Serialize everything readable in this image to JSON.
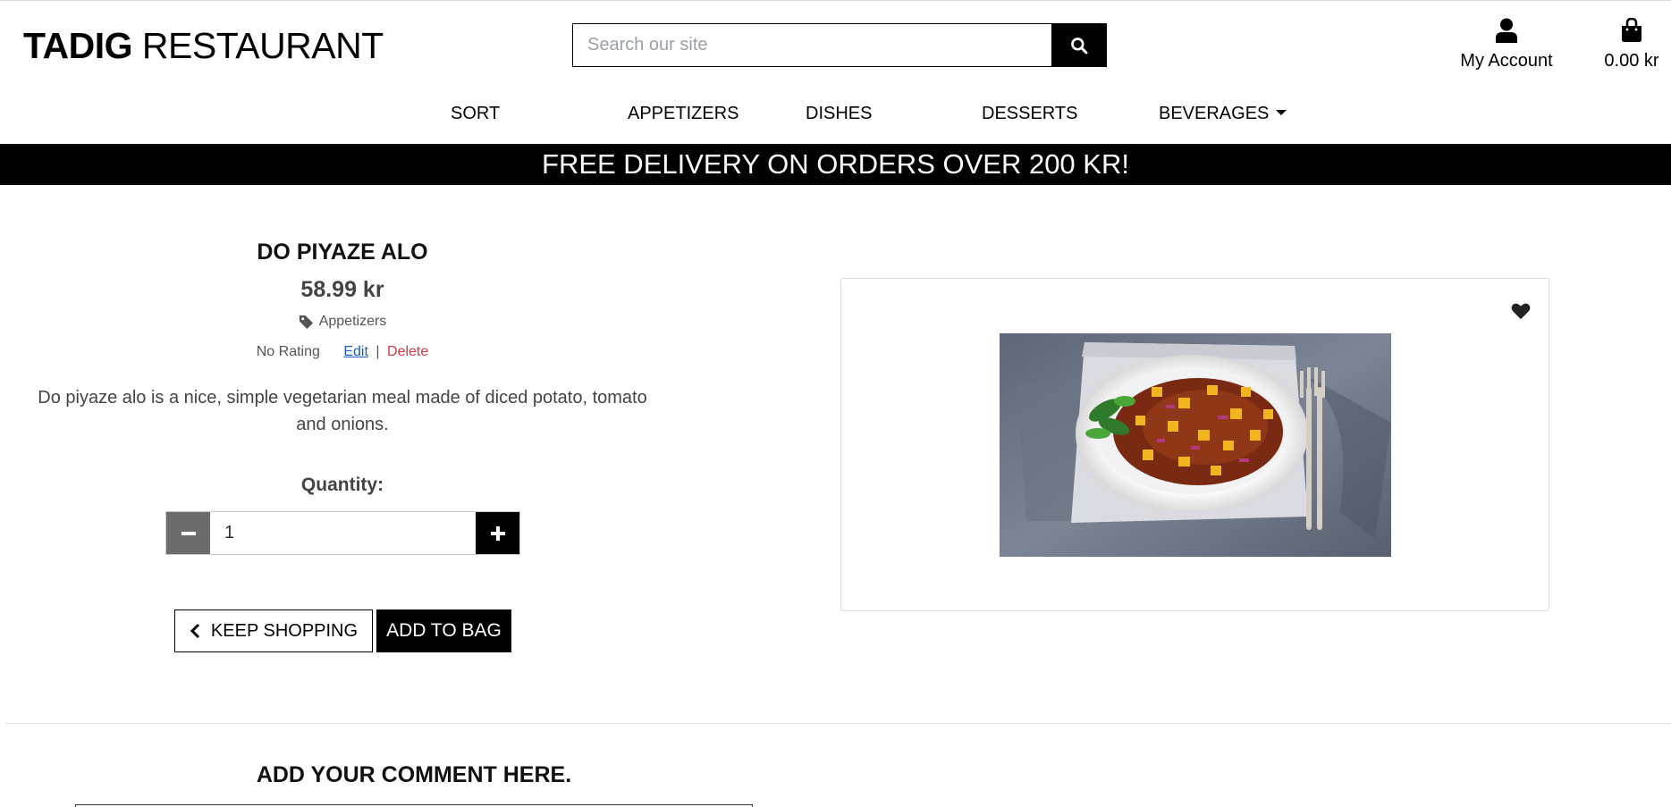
{
  "header": {
    "logo_bold": "TADIG",
    "logo_rest": "RESTAURANT",
    "search_placeholder": "Search our site",
    "account_label": "My Account",
    "bag_total": "0.00 kr"
  },
  "nav": {
    "sort": "SORT",
    "appetizers": "APPETIZERS",
    "dishes": "DISHES",
    "desserts": "DESSERTS",
    "beverages": "BEVERAGES"
  },
  "banner": "FREE DELIVERY ON ORDERS OVER 200 KR!",
  "product": {
    "name": "DO PIYAZE ALO",
    "price": "58.99 kr",
    "category": "Appetizers",
    "rating": "No Rating",
    "edit_label": "Edit",
    "separator": "|",
    "delete_label": "Delete",
    "description": "Do piyaze alo is a nice, simple vegetarian meal made of diced potato, tomato and onions.",
    "quantity_label": "Quantity:",
    "quantity_value": "1"
  },
  "actions": {
    "keep_shopping": "KEEP SHOPPING",
    "add_to_bag": "ADD TO BAG"
  },
  "comments": {
    "title": "ADD YOUR COMMENT HERE."
  },
  "icons": {
    "search": "search-icon",
    "account": "user-icon",
    "bag": "shopping-bag-icon",
    "tag": "tag-icon",
    "minus": "minus-icon",
    "plus": "plus-icon",
    "back": "chevron-left-icon",
    "wishlist": "heart-icon"
  }
}
